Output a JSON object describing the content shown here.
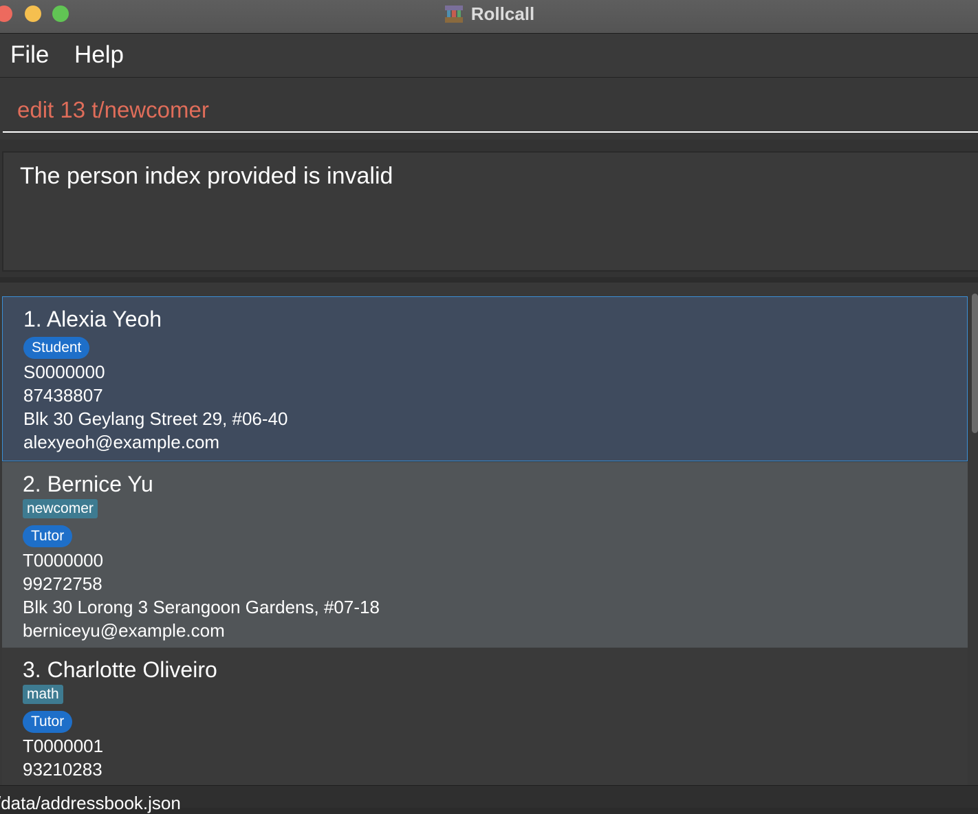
{
  "window": {
    "title": "Rollcall",
    "icon": "rollcall-app-icon"
  },
  "menu": {
    "file": "File",
    "help": "Help"
  },
  "command": {
    "value": "edit 13 t/newcomer",
    "color": "#e06d5a"
  },
  "result": {
    "message": "The person index provided is invalid"
  },
  "persons": [
    {
      "index_name": "1. Alexia Yeoh",
      "tags": [],
      "role": "Student",
      "id": "S0000000",
      "phone": "87438807",
      "address": "Blk 30 Geylang Street 29, #06-40",
      "email": "alexyeoh@example.com",
      "selected": true
    },
    {
      "index_name": "2. Bernice Yu",
      "tags": [
        "newcomer"
      ],
      "role": "Tutor",
      "id": "T0000000",
      "phone": "99272758",
      "address": "Blk 30 Lorong 3 Serangoon Gardens, #07-18",
      "email": "berniceyu@example.com",
      "selected": false
    },
    {
      "index_name": "3. Charlotte Oliveiro",
      "tags": [
        "math"
      ],
      "role": "Tutor",
      "id": "T0000001",
      "phone": "93210283",
      "selected": false
    }
  ],
  "status": {
    "path": "/data/addressbook.json"
  },
  "colors": {
    "role_badge": "#1e6fc9",
    "tag_badge": "#3e7b91",
    "selected_card": "#3f4b5e"
  }
}
